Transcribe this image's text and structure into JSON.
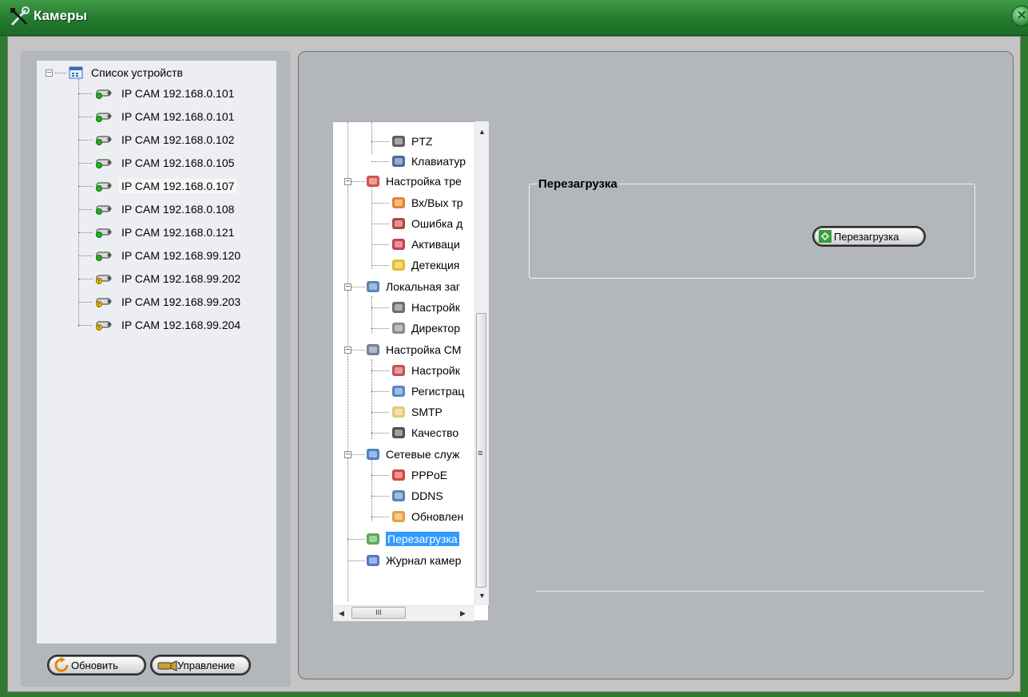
{
  "window": {
    "title": "Камеры",
    "close_glyph": "✕"
  },
  "device_tree": {
    "root_label": "Список устройств",
    "devices": [
      {
        "label": "IP CAM 192.168.0.101",
        "status": "online",
        "selected": false
      },
      {
        "label": "IP CAM 192.168.0.101",
        "status": "online",
        "selected": false
      },
      {
        "label": "IP CAM 192.168.0.102",
        "status": "online",
        "selected": false
      },
      {
        "label": "IP CAM 192.168.0.105",
        "status": "online",
        "selected": false
      },
      {
        "label": "IP CAM 192.168.0.107",
        "status": "online",
        "selected": true
      },
      {
        "label": "IP CAM 192.168.0.108",
        "status": "online",
        "selected": false
      },
      {
        "label": "IP CAM 192.168.0.121",
        "status": "online",
        "selected": false
      },
      {
        "label": "IP CAM 192.168.99.120",
        "status": "online",
        "selected": false
      },
      {
        "label": "IP CAM 192.168.99.202",
        "status": "unknown",
        "selected": false
      },
      {
        "label": "IP CAM 192.168.99.203",
        "status": "unknown",
        "selected": false
      },
      {
        "label": "IP CAM 192.168.99.204",
        "status": "unknown",
        "selected": false
      }
    ]
  },
  "buttons": {
    "refresh": "Обновить",
    "manage": "Управление"
  },
  "settings_tree": {
    "items": [
      {
        "label": "PTZ",
        "level": 2,
        "icon": "ptz-camera-icon"
      },
      {
        "label": "Клавиатур",
        "level": 2,
        "icon": "keyboard-icon"
      },
      {
        "label": "Настройка тре",
        "level": 1,
        "icon": "alarm-settings-icon"
      },
      {
        "label": "Вх/Вых тр",
        "level": 2,
        "icon": "io-alarm-icon"
      },
      {
        "label": "Ошибка д",
        "level": 2,
        "icon": "disk-error-icon"
      },
      {
        "label": "Активаци",
        "level": 2,
        "icon": "activation-icon"
      },
      {
        "label": "Детекция",
        "level": 2,
        "icon": "motion-detection-icon"
      },
      {
        "label": "Локальная заг",
        "level": 1,
        "icon": "local-storage-icon"
      },
      {
        "label": "Настройк",
        "level": 2,
        "icon": "storage-settings-icon"
      },
      {
        "label": "Директор",
        "level": 2,
        "icon": "directory-icon"
      },
      {
        "label": "Настройка СМ",
        "level": 1,
        "icon": "sms-settings-icon"
      },
      {
        "label": "Настройк",
        "level": 2,
        "icon": "sms-config-icon"
      },
      {
        "label": "Регистрац",
        "level": 2,
        "icon": "registration-icon"
      },
      {
        "label": "SMTP",
        "level": 2,
        "icon": "envelope-icon"
      },
      {
        "label": "Качество",
        "level": 2,
        "icon": "quality-icon"
      },
      {
        "label": "Сетевые служ",
        "level": 1,
        "icon": "network-services-icon"
      },
      {
        "label": "PPPoE",
        "level": 2,
        "icon": "phone-icon"
      },
      {
        "label": "DDNS",
        "level": 2,
        "icon": "ddns-icon"
      },
      {
        "label": "Обновлен",
        "level": 2,
        "icon": "update-icon"
      },
      {
        "label": "Перезагрузка",
        "level": 1,
        "icon": "reboot-icon",
        "selected": true
      },
      {
        "label": "Журнал камер",
        "level": 1,
        "icon": "calendar-log-icon"
      }
    ],
    "hscroll_thumb": "III"
  },
  "reboot_panel": {
    "group_title": "Перезагрузка",
    "button_label": "Перезагрузка"
  }
}
